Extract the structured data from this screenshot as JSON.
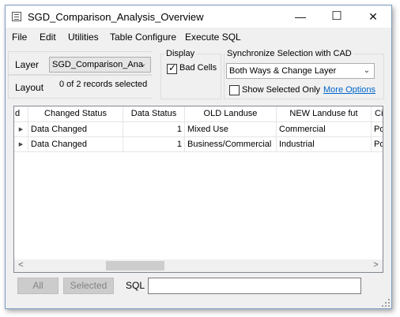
{
  "window": {
    "title": "SGD_Comparison_Analysis_Overview",
    "controls": {
      "minimize": "—",
      "maximize": "☐",
      "close": "✕"
    }
  },
  "menu": [
    "File",
    "Edit",
    "Utilities",
    "Table Configure",
    "Execute SQL"
  ],
  "layer": {
    "label": "Layer",
    "value": "SGD_Comparison_Ana"
  },
  "layout": {
    "label": "Layout",
    "records": "0 of 2 records selected"
  },
  "display": {
    "title": "Display",
    "bad_cells_label": "Bad Cells",
    "bad_cells_checked": true
  },
  "sync": {
    "title": "Synchronize Selection with CAD",
    "value": "Both Ways & Change Layer",
    "show_selected_label": "Show Selected Only",
    "show_selected_checked": false,
    "more_options": "More Options"
  },
  "table": {
    "columns": [
      "d",
      "Changed Status",
      "Data Status",
      "OLD Landuse",
      "NEW Landuse fut",
      "City"
    ],
    "rows": [
      [
        "Data Changed",
        "1",
        "Mixed Use",
        "Commercial",
        "Poly"
      ],
      [
        "Data Changed",
        "1",
        "Business/Commercial",
        "Industrial",
        "Poly"
      ]
    ]
  },
  "scrollbar": {
    "left": "<",
    "right": ">"
  },
  "footer": {
    "all_button": "All",
    "selected_button": "Selected",
    "sql_label": "SQL",
    "sql_value": ""
  },
  "colors": {
    "link": "#0066cc",
    "border": "#7a9cc4",
    "disabled_text": "#838383"
  }
}
